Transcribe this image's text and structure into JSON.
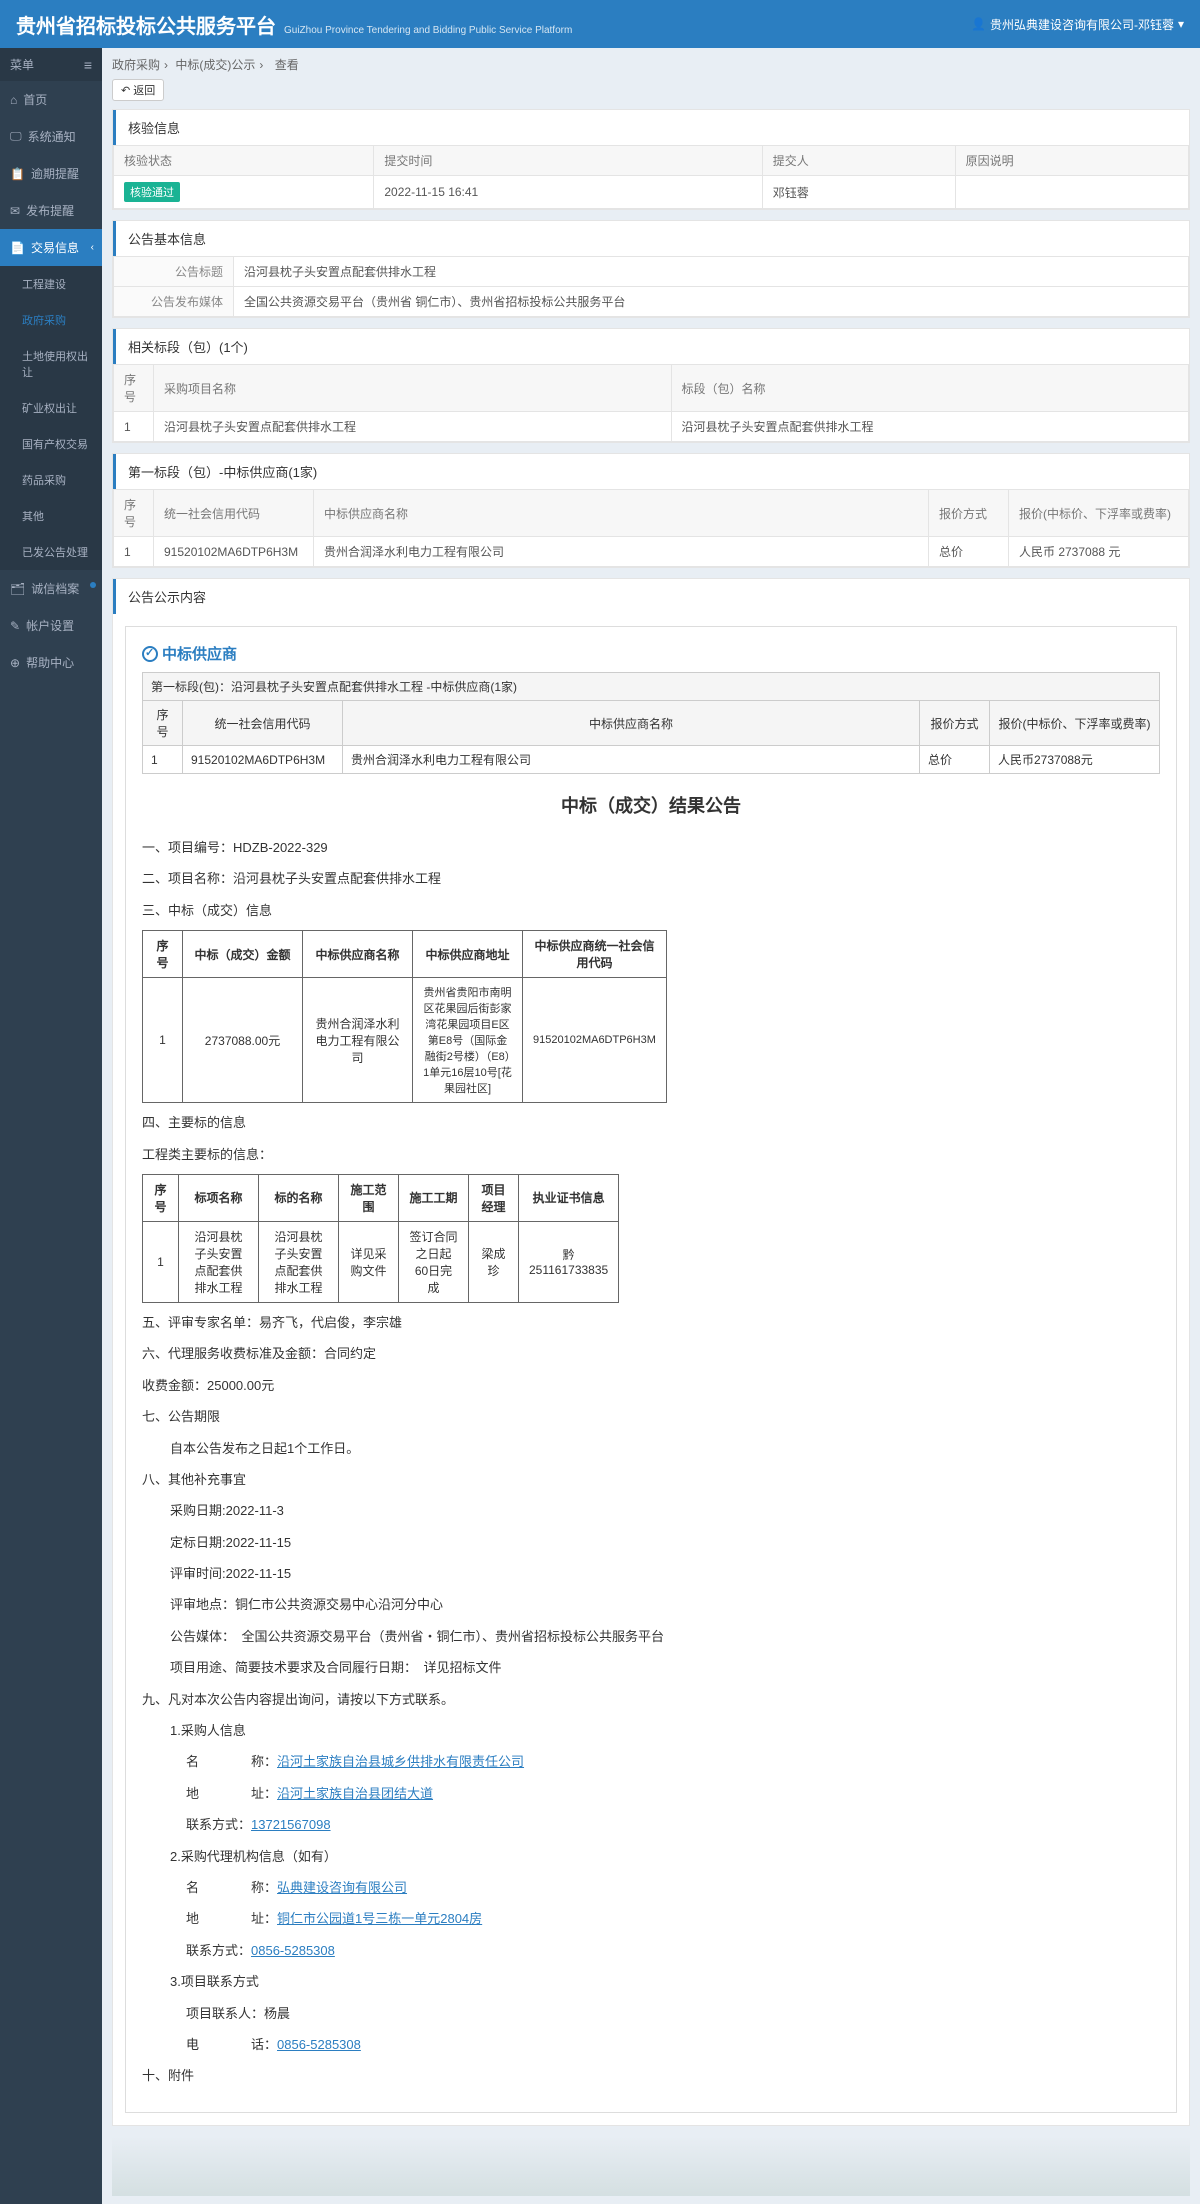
{
  "header": {
    "title": "贵州省招标投标公共服务平台",
    "subtitle": "GuiZhou Province Tendering and Bidding Public Service Platform",
    "user": "贵州弘典建设咨询有限公司-邓钰蓉"
  },
  "sidebar": {
    "head": "菜单",
    "items": [
      {
        "label": "首页"
      },
      {
        "label": "系统通知"
      },
      {
        "label": "逾期提醒"
      },
      {
        "label": "发布提醒"
      },
      {
        "label": "交易信息",
        "active": true,
        "sub": [
          {
            "label": "工程建设"
          },
          {
            "label": "政府采购",
            "on": true
          },
          {
            "label": "土地使用权出让"
          },
          {
            "label": "矿业权出让"
          },
          {
            "label": "国有产权交易"
          },
          {
            "label": "药品采购"
          },
          {
            "label": "其他"
          },
          {
            "label": "已发公告处理"
          }
        ]
      },
      {
        "label": "诚信档案",
        "dot": true
      },
      {
        "label": "帐户设置"
      },
      {
        "label": "帮助中心"
      }
    ]
  },
  "breadcrumb": {
    "a": "政府采购",
    "b": "中标(成交)公示",
    "c": "查看"
  },
  "back": "返回",
  "verify": {
    "title": "核验信息",
    "cols": {
      "status": "核验状态",
      "time": "提交时间",
      "person": "提交人",
      "reason": "原因说明"
    },
    "badge": "核验通过",
    "time": "2022-11-15 16:41",
    "person": "邓钰蓉",
    "reason": ""
  },
  "basic": {
    "title": "公告基本信息",
    "name_lbl": "公告标题",
    "name": "沿河县枕子头安置点配套供排水工程",
    "media_lbl": "公告发布媒体",
    "media": "全国公共资源交易平台（贵州省 铜仁市）、贵州省招标投标公共服务平台"
  },
  "related": {
    "title": "相关标段（包）(1个)",
    "h": {
      "no": "序号",
      "name": "采购项目名称",
      "pkg": "标段（包）名称"
    },
    "row": {
      "no": "1",
      "name": "沿河县枕子头安置点配套供排水工程",
      "pkg": "沿河县枕子头安置点配套供排水工程"
    }
  },
  "winner1": {
    "title": "第一标段（包）-中标供应商(1家)",
    "h": {
      "no": "序号",
      "code": "统一社会信用代码",
      "name": "中标供应商名称",
      "method": "报价方式",
      "price": "报价(中标价、下浮率或费率)"
    },
    "row": {
      "no": "1",
      "code": "91520102MA6DTP6H3M",
      "name": "贵州合润泽水利电力工程有限公司",
      "method": "总价",
      "price": "人民币 2737088 元"
    }
  },
  "content": {
    "title": "公告公示内容",
    "sup": "中标供应商",
    "caption": "第一标段(包)：沿河县枕子头安置点配套供排水工程 -中标供应商(1家)",
    "h": {
      "no": "序号",
      "code": "统一社会信用代码",
      "name": "中标供应商名称",
      "method": "报价方式",
      "price": "报价(中标价、下浮率或费率)"
    },
    "row": {
      "no": "1",
      "code": "91520102MA6DTP6H3M",
      "name": "贵州合润泽水利电力工程有限公司",
      "method": "总价",
      "price": "人民币2737088元"
    }
  },
  "announce": {
    "title": "中标（成交）结果公告",
    "s1": "一、项目编号：HDZB-2022-329",
    "s2": "二、项目名称：沿河县枕子头安置点配套供排水工程",
    "s3": "三、中标（成交）信息",
    "t1h": {
      "no": "序号",
      "amount": "中标（成交）金额",
      "name": "中标供应商名称",
      "addr": "中标供应商地址",
      "code": "中标供应商统一社会信用代码"
    },
    "t1r": {
      "no": "1",
      "amount": "2737088.00元",
      "name": "贵州合润泽水利电力工程有限公司",
      "addr": "贵州省贵阳市南明区花果园后街彭家湾花果园项目E区第E8号（国际金融街2号楼）（E8）1单元16层10号[花果园社区]",
      "code": "91520102MA6DTP6H3M"
    },
    "s4": "四、主要标的信息",
    "s4a": "工程类主要标的信息：",
    "t2h": {
      "no": "序号",
      "item": "标项名称",
      "target": "标的名称",
      "scope": "施工范围",
      "period": "施工工期",
      "mgr": "项目经理",
      "cert": "执业证书信息"
    },
    "t2r": {
      "no": "1",
      "item": "沿河县枕子头安置点配套供排水工程",
      "target": "沿河县枕子头安置点配套供排水工程",
      "scope": "详见采购文件",
      "period": "签订合同之日起60日完成",
      "mgr": "梁成珍",
      "cert": "黔251161733835"
    },
    "s5": "五、评审专家名单：易齐飞，代启俊，李宗雄",
    "s6": "六、代理服务收费标准及金额：合同约定",
    "s6a": "收费金额：25000.00元",
    "s7": "七、公告期限",
    "s7a": "自本公告发布之日起1个工作日。",
    "s8": "八、其他补充事宜",
    "s8a": "采购日期:2022-11-3",
    "s8b": "定标日期:2022-11-15",
    "s8c": "评审时间:2022-11-15",
    "s8d": "评审地点：铜仁市公共资源交易中心沿河分中心",
    "s8e": "公告媒体：　全国公共资源交易平台（贵州省・铜仁市）、贵州省招标投标公共服务平台",
    "s8f": "项目用途、简要技术要求及合同履行日期：　详见招标文件",
    "s9": "九、凡对本次公告内容提出询问，请按以下方式联系。",
    "s9_1": "1.采购人信息",
    "s9_1n_lbl": "名　　　　称：",
    "s9_1n": "沿河土家族自治县城乡供排水有限责任公司",
    "s9_1a_lbl": "地　　　　址：",
    "s9_1a": "沿河土家族自治县团结大道",
    "s9_1t_lbl": "联系方式：",
    "s9_1t": "13721567098",
    "s9_2": "2.采购代理机构信息（如有）",
    "s9_2n_lbl": "名　　　　称：",
    "s9_2n": "弘典建设咨询有限公司",
    "s9_2a_lbl": "地　　　　址：",
    "s9_2a": "铜仁市公园道1号三栋一单元2804房",
    "s9_2t_lbl": "联系方式：",
    "s9_2t": "0856-5285308",
    "s9_3": "3.项目联系方式",
    "s9_3n": "项目联系人：杨晨",
    "s9_3t_lbl": "电　　　　话：",
    "s9_3t": "0856-5285308",
    "s10": "十、附件"
  }
}
